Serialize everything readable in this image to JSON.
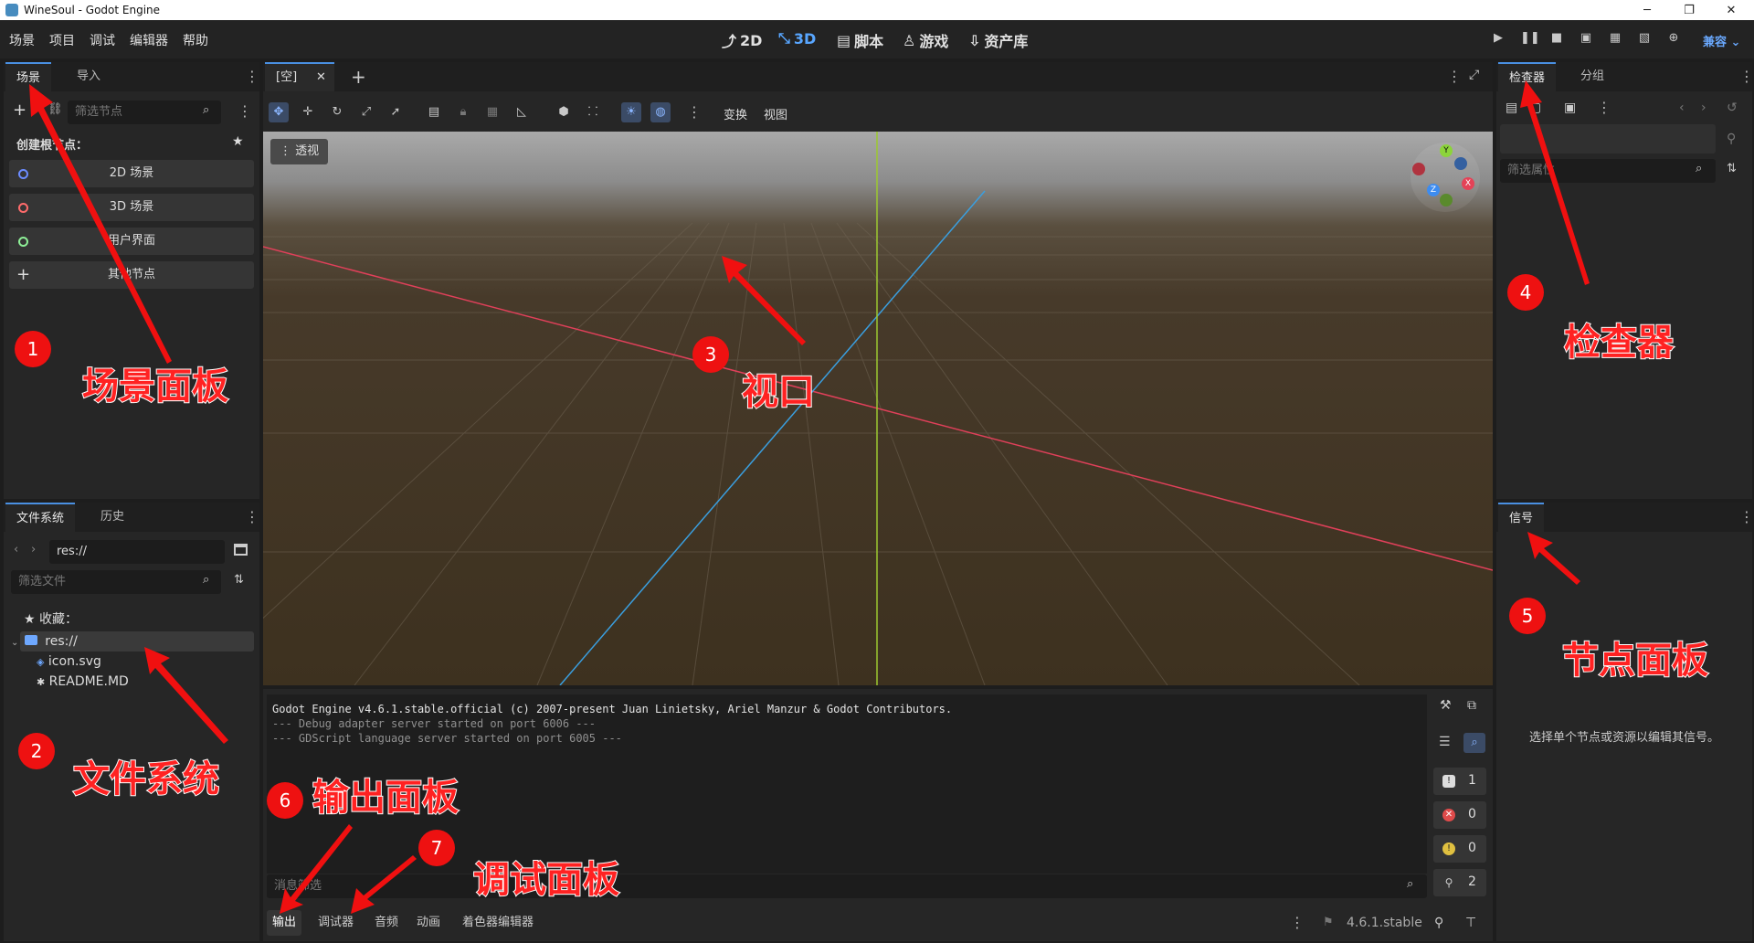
{
  "window": {
    "title": "WineSoul - Godot Engine",
    "min": "─",
    "max": "❐",
    "close": "✕"
  },
  "menu": [
    "场景",
    "项目",
    "调试",
    "编辑器",
    "帮助"
  ],
  "workspaces": [
    {
      "label": "2D",
      "icon": "2d-icon"
    },
    {
      "label": "3D",
      "icon": "3d-icon"
    },
    {
      "label": "脚本",
      "icon": "script-icon"
    },
    {
      "label": "游戏",
      "icon": "game-icon"
    },
    {
      "label": "资产库",
      "icon": "asset-lib-icon"
    }
  ],
  "renderer": "兼容",
  "scene_dock": {
    "tabs": [
      "场景",
      "导入"
    ],
    "filter_placeholder": "筛选节点",
    "create_root_label": "创建根节点：",
    "buttons": [
      "2D 场景",
      "3D 场景",
      "用户界面",
      "其他节点"
    ],
    "ring_colors": [
      "#6c8cff",
      "#ff6b6b",
      "#8eef97"
    ]
  },
  "fs_dock": {
    "tabs": [
      "文件系统",
      "历史"
    ],
    "path": "res://",
    "filter_placeholder": "筛选文件",
    "favorites": "收藏：",
    "root": "res://",
    "files": [
      "icon.svg",
      "README.MD"
    ]
  },
  "viewport": {
    "tab_label": "[空]",
    "menus": [
      "变换",
      "视图"
    ],
    "perspective": "透视",
    "gizmo": {
      "y": "Y",
      "x": "X",
      "z": "Z"
    }
  },
  "output": {
    "lines": [
      "Godot Engine v4.6.1.stable.official (c) 2007-present Juan Linietsky, Ariel Manzur & Godot Contributors.",
      "--- Debug adapter server started on port 6006 ---",
      "--- GDScript language server started on port 6005 ---"
    ],
    "filter_placeholder": "消息筛选",
    "counts": [
      "1",
      "0",
      "0",
      "2"
    ]
  },
  "bottom_tabs": [
    "输出",
    "调试器",
    "音频",
    "动画",
    "着色器编辑器"
  ],
  "version": "4.6.1.stable",
  "inspector": {
    "tabs": [
      "检查器",
      "分组"
    ],
    "filter_placeholder": "筛选属性"
  },
  "signals": {
    "tab": "信号",
    "hint": "选择单个节点或资源以编辑其信号。"
  },
  "annotations": {
    "labels": [
      "场景面板",
      "文件系统",
      "视口",
      "检查器",
      "节点面板",
      "输出面板",
      "调试面板"
    ],
    "numbers": [
      "1",
      "2",
      "3",
      "4",
      "5",
      "6",
      "7"
    ]
  }
}
